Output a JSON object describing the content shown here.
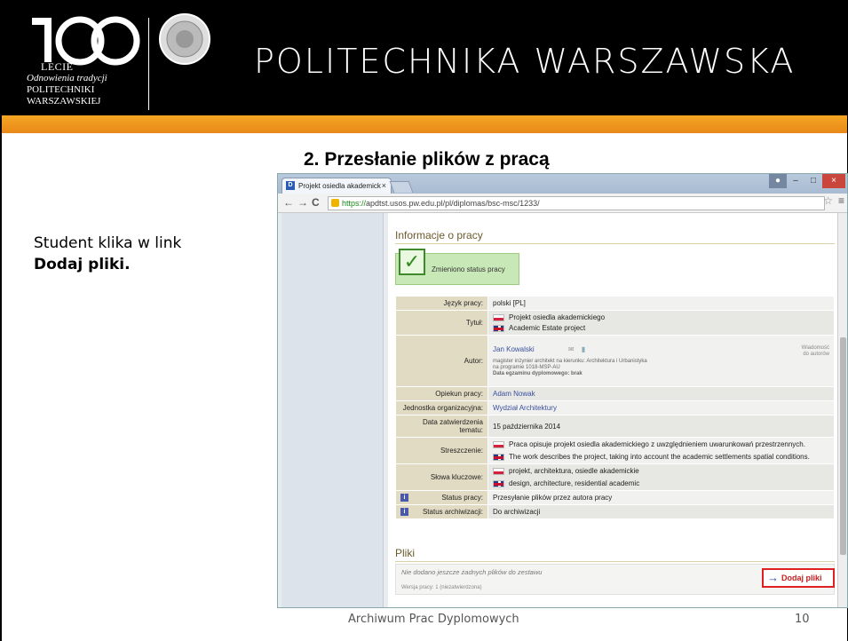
{
  "header": {
    "logo_lecie": "LECIE",
    "logo_line2": "Odnowienia tradycji",
    "logo_line3": "POLITECHNIKI",
    "logo_line4": "WARSZAWSKIEJ",
    "university_name": "POLITECHNIKA WARSZAWSKA"
  },
  "slide": {
    "title": "2. Przesłanie plików z pracą",
    "instruction_line1": "Student klika w link",
    "instruction_line2": "Dodaj pliki.",
    "footer": "Archiwum Prac Dyplomowych",
    "page_number": "10"
  },
  "browser": {
    "tab_title": "Projekt osiedla akademick",
    "tab_close": "×",
    "favicon": "D",
    "url_https": "https://",
    "url_rest": "apdtst.usos.pw.edu.pl/pl/diplomas/bsc-msc/1233/",
    "nav_back": "←",
    "nav_forward": "→",
    "nav_reload": "C",
    "star": "☆",
    "menu": "≡",
    "win_min": "–",
    "win_max": "□",
    "win_close": "×"
  },
  "page": {
    "section_info": "Informacje o pracy",
    "status_message": "Zmieniono status pracy",
    "rows": {
      "lang_label": "Język pracy:",
      "lang_value": "polski [PL]",
      "title_label": "Tytuł:",
      "title_pl": "Projekt osiedla akademickiego",
      "title_en": "Academic Estate project",
      "author_label": "Autor:",
      "author_name": "Jan Kowalski",
      "author_detail1": "magister inżynier architekt na kierunku: Architektura i Urbanistyka",
      "author_detail2": "na programie 1018-MSP-AU",
      "author_detail3": "Data egzaminu dyplomowego: brak",
      "message_to_authors_1": "Wiadomość",
      "message_to_authors_2": "do autorów",
      "supervisor_label": "Opiekun pracy:",
      "supervisor_value": "Adam Nowak",
      "unit_label": "Jednostka organizacyjna:",
      "unit_value": "Wydział Architektury",
      "date_label": "Data zatwierdzenia tematu:",
      "date_value": "15 października 2014",
      "abstract_label": "Streszczenie:",
      "abstract_pl": "Praca opisuje projekt osiedla akademickiego z uwzględnieniem uwarunkowań przestrzennych.",
      "abstract_en": "The work describes the project, taking into account the academic settlements spatial conditions.",
      "keywords_label": "Słowa kluczowe:",
      "keywords_pl": "projekt, architektura, osiedle akademickie",
      "keywords_en": "design, architecture, residential academic",
      "status_label": "Status pracy:",
      "status_value": "Przesyłanie plików przez autora pracy",
      "archive_label": "Status archiwizacji:",
      "archive_value": "Do archiwizacji",
      "info_icon": "i"
    },
    "section_files": "Pliki",
    "no_files": "Nie dodano jeszcze żadnych plików do zestawu",
    "version": "Wersja pracy: 1 (niezatwierdzona)",
    "add_files_button": "Dodaj pliki",
    "add_arrow": "→"
  },
  "colors": {
    "orange_bar": "#f5a623",
    "highlight_red": "#e02020"
  }
}
